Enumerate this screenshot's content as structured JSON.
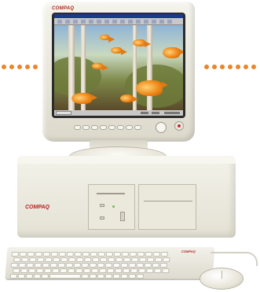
{
  "scene": {
    "monitor": {
      "brand": "COMPAQ",
      "model": "",
      "window_title": "",
      "icons": [
        "power-button-icon",
        "compaq-logo-badge-icon"
      ]
    },
    "base_unit": {
      "brand": "COMPAQ",
      "series": ""
    },
    "keyboard": {
      "brand": "COMPAQ"
    },
    "accent_colors": {
      "dots": "#e8862a",
      "brand_red": "#b32222",
      "chassis": "#e7e5d9"
    }
  }
}
